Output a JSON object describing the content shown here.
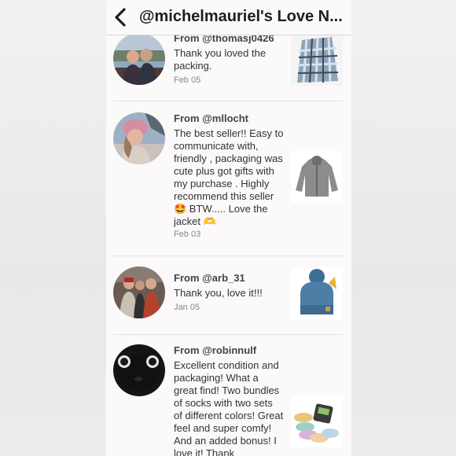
{
  "header": {
    "title": "@michelmauriel's Love N..."
  },
  "reviews": [
    {
      "from": "From @thomasj0426",
      "text": "Thank you loved the packing.",
      "date": "Feb 05",
      "avatar_desc": "avatar-photo-couple",
      "thumb_desc": "plaid-shirt-photo"
    },
    {
      "from": "From @mllocht",
      "text": "The best seller!! Easy to communicate with, friendly , packaging was cute plus got gifts with my purchase . Highly recommend this seller 🤩 BTW..... Love the jacket 🫶",
      "date": "Feb 03",
      "avatar_desc": "avatar-photo-woman-pink-hat",
      "thumb_desc": "gray-jacket-photo"
    },
    {
      "from": "From @arb_31",
      "text": "Thank you, love it!!!",
      "date": "Jan 05",
      "avatar_desc": "avatar-photo-group",
      "thumb_desc": "blue-beanie-photo"
    },
    {
      "from": "From @robinnulf",
      "text": "Excellent condition and packaging! What a great find! Two bundles of socks with two sets of different colors! Great feel and super comfy! And an added bonus! I love it! Thank",
      "date": "",
      "avatar_desc": "avatar-photo-black-cat",
      "thumb_desc": "socks-photo"
    }
  ]
}
